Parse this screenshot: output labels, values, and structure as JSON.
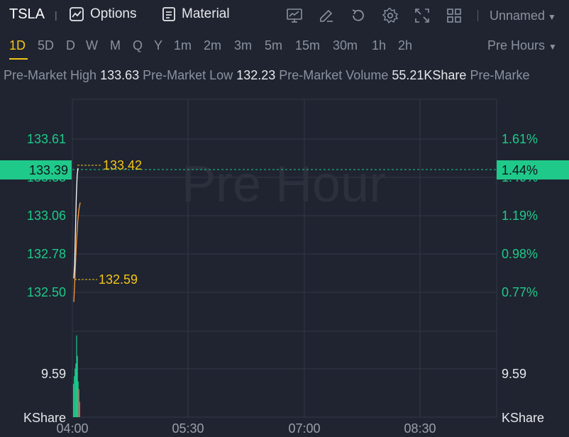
{
  "toolbar": {
    "symbol": "TSLA",
    "separator": "|",
    "options_label": "Options",
    "material_label": "Material",
    "layout_name": "Unnamed",
    "icons": [
      "chart-indicator-icon",
      "draw-icon",
      "reset-icon",
      "settings-icon",
      "fullscreen-icon",
      "layout-grid-icon"
    ]
  },
  "periods": {
    "items": [
      "1D",
      "5D",
      "D",
      "W",
      "M",
      "Q",
      "Y",
      "1m",
      "2m",
      "3m",
      "5m",
      "15m",
      "30m",
      "1h",
      "2h"
    ],
    "active": "1D",
    "session_label": "Pre Hours"
  },
  "stats": {
    "high_label": "Pre-Market High",
    "high_value": "133.63",
    "low_label": "Pre-Market Low",
    "low_value": "132.23",
    "volume_label": "Pre-Market Volume",
    "volume_value": "55.21KShare",
    "trailing_label": "Pre-Marke"
  },
  "colors": {
    "background": "#1f2430",
    "grid": "#323846",
    "up": "#1fc98a",
    "down": "#ff4d5a",
    "accent": "#f5c518",
    "price_line": "#ffffff",
    "avg_line": "#ff9a3c"
  },
  "chart_data": {
    "type": "line",
    "watermark": "Pre Hour",
    "x_ticks": [
      "04:00",
      "05:30",
      "07:00",
      "08:30"
    ],
    "y_ticks_price": [
      "133.61",
      "133.33",
      "133.06",
      "132.78",
      "132.50"
    ],
    "y_ticks_pct": [
      "1.61%",
      "1.40%",
      "1.19%",
      "0.98%",
      "0.77%"
    ],
    "current_price": "133.39",
    "current_pct": "1.44%",
    "marker_high": "133.42",
    "marker_low": "132.59",
    "volume_tick": "9.59",
    "volume_unit": "KShare",
    "price_series": [
      {
        "t": 0.0,
        "v": 132.6
      },
      {
        "t": 0.4,
        "v": 132.7
      },
      {
        "t": 0.8,
        "v": 132.95
      },
      {
        "t": 1.2,
        "v": 133.2
      },
      {
        "t": 1.6,
        "v": 133.35
      },
      {
        "t": 2.0,
        "v": 133.4
      }
    ],
    "avg_series": [
      {
        "t": 0.0,
        "v": 132.43
      },
      {
        "t": 0.6,
        "v": 132.62
      },
      {
        "t": 1.2,
        "v": 132.85
      },
      {
        "t": 1.8,
        "v": 133.0
      },
      {
        "t": 2.4,
        "v": 133.1
      },
      {
        "t": 3.0,
        "v": 133.15
      }
    ],
    "volume_bars": [
      {
        "t": 0.0,
        "v": 6.5,
        "dir": "up"
      },
      {
        "t": 1.0,
        "v": 8.0,
        "dir": "up"
      },
      {
        "t": 2.0,
        "v": 9.5,
        "dir": "up"
      },
      {
        "t": 3.0,
        "v": 10.5,
        "dir": "up"
      },
      {
        "t": 4.0,
        "v": 16.0,
        "dir": "up"
      },
      {
        "t": 5.0,
        "v": 12.0,
        "dir": "up"
      },
      {
        "t": 6.0,
        "v": 7.0,
        "dir": "up"
      },
      {
        "t": 7.0,
        "v": 5.5,
        "dir": "down"
      },
      {
        "t": 8.0,
        "v": 3.0,
        "dir": "down"
      }
    ]
  }
}
